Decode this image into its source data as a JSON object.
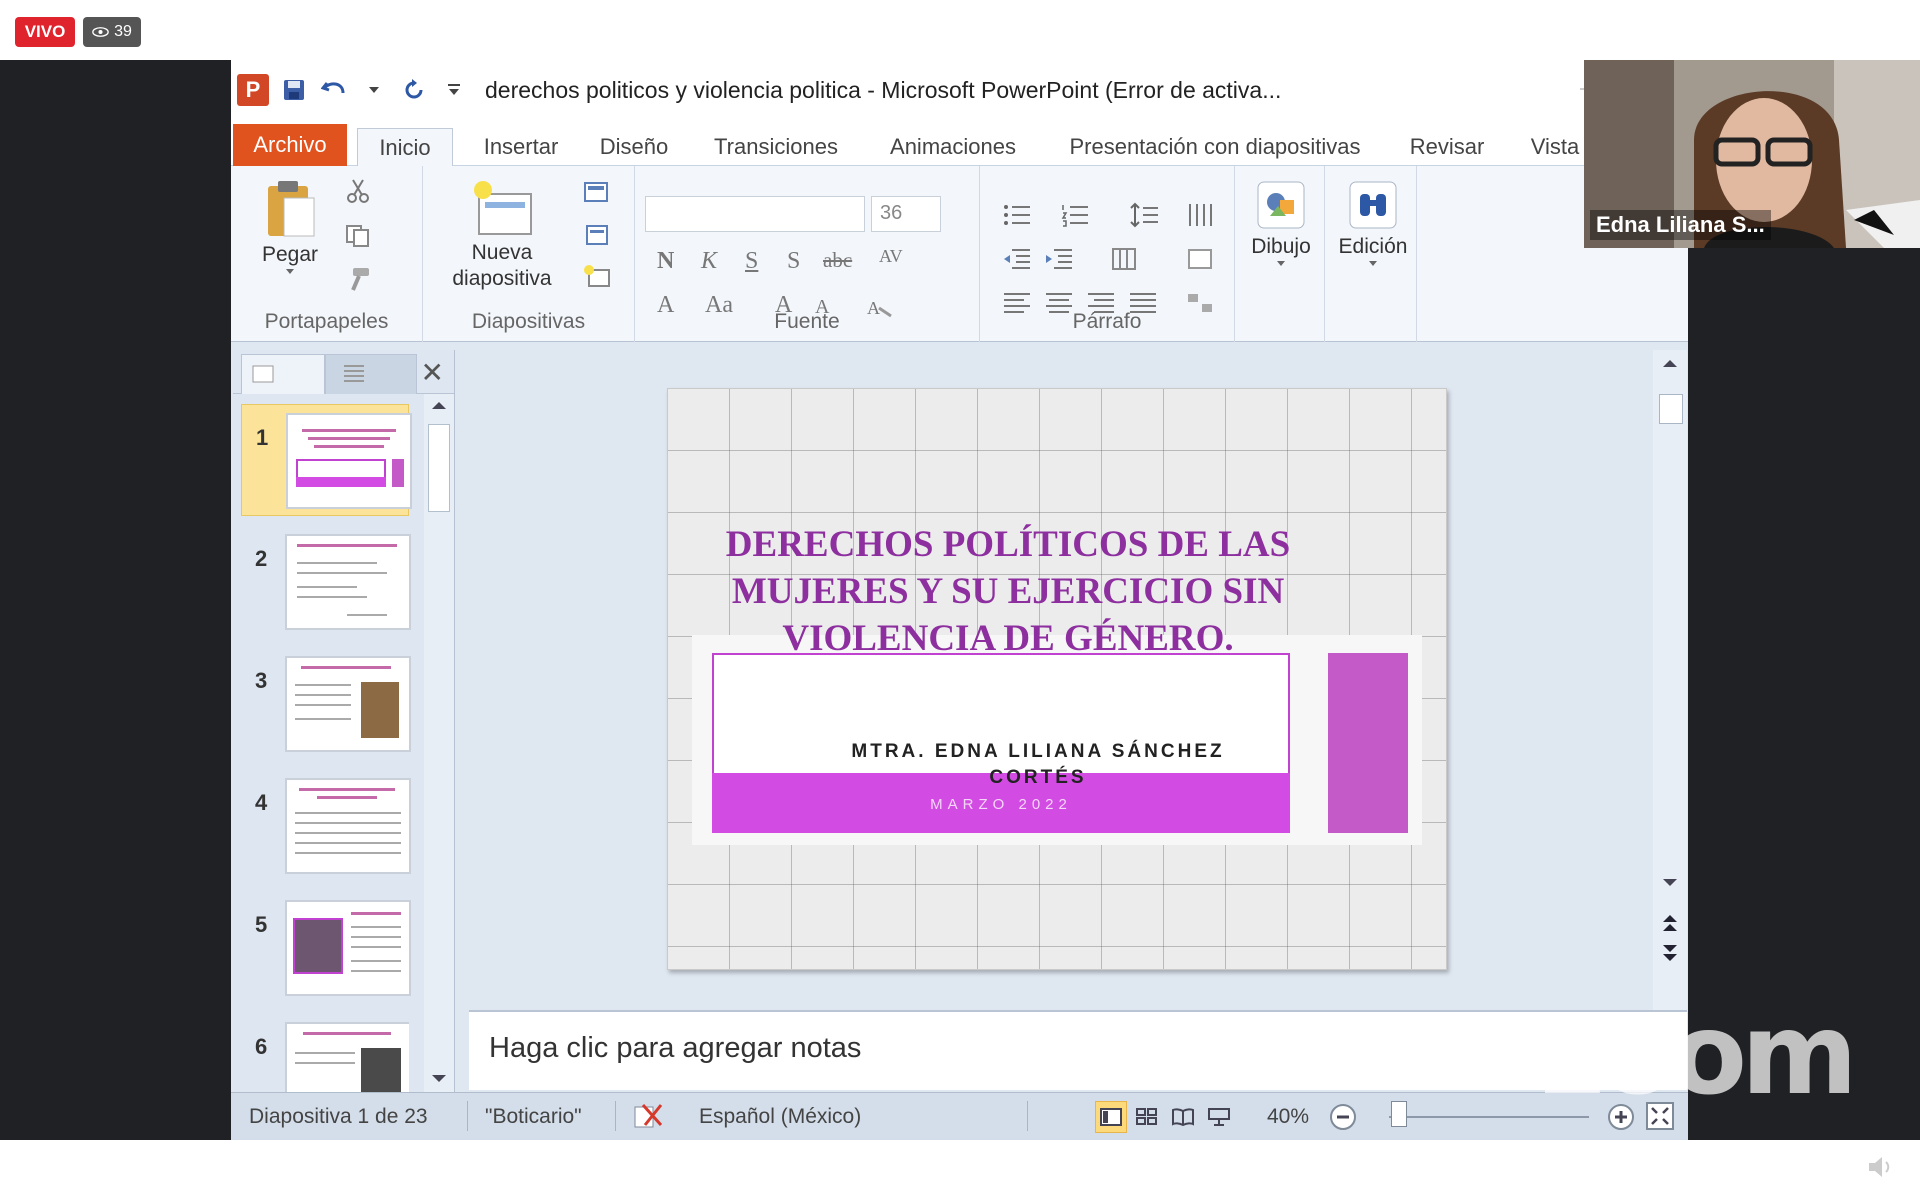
{
  "stream": {
    "live_label": "VIVO",
    "viewers": "39"
  },
  "window": {
    "title": "derechos politicos y violencia politica  -  Microsoft PowerPoint (Error de activa..."
  },
  "ribbon_tabs": [
    {
      "label": "Archivo"
    },
    {
      "label": "Inicio"
    },
    {
      "label": "Insertar"
    },
    {
      "label": "Diseño"
    },
    {
      "label": "Transiciones"
    },
    {
      "label": "Animaciones"
    },
    {
      "label": "Presentación con diapositivas"
    },
    {
      "label": "Revisar"
    },
    {
      "label": "Vista"
    }
  ],
  "ribbon": {
    "paste_label": "Pegar",
    "new_slide_label_1": "Nueva",
    "new_slide_label_2": "diapositiva",
    "font_size": "36",
    "drawing_label": "Dibujo",
    "editing_label": "Edición",
    "group_clipboard": "Portapapeles",
    "group_slides": "Diapositivas",
    "group_font": "Fuente",
    "group_paragraph": "Párrafo"
  },
  "slide_thumbnails": [
    {
      "num": "1"
    },
    {
      "num": "2"
    },
    {
      "num": "3"
    },
    {
      "num": "4"
    },
    {
      "num": "5"
    },
    {
      "num": "6"
    }
  ],
  "slide": {
    "title": "DERECHOS POLÍTICOS DE LAS MUJERES Y SU EJERCICIO SIN VIOLENCIA DE GÉNERO.",
    "author": "MTRA.  EDNA LILIANA SÁNCHEZ CORTÉS",
    "date": "MARZO 2022"
  },
  "notes_placeholder": "Haga clic para agregar notas",
  "status": {
    "slide_info": "Diapositiva 1 de 23",
    "theme": "\"Boticario\"",
    "language": "Español (México)",
    "zoom": "40%"
  },
  "webcam": {
    "name": "Edna Liliana S..."
  },
  "watermark": "zoom",
  "colors": {
    "live_red": "#e0242d",
    "file_tab": "#e0531f",
    "slide_purple": "#8d2f9f",
    "slide_band": "#d24ce3"
  }
}
